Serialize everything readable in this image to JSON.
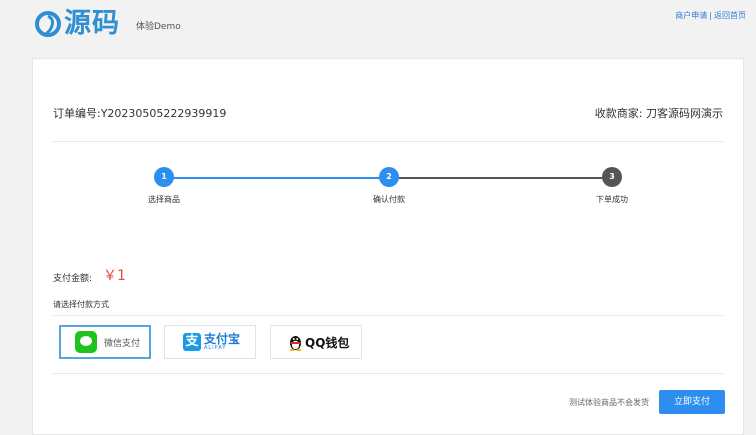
{
  "header": {
    "logo_text": "源码",
    "demo_label": "体验Demo",
    "links": {
      "merchant_apply": "商户申请",
      "separator": "|",
      "back_home": "返回首页"
    }
  },
  "order": {
    "number": "订单编号:Y20230505222939919",
    "merchant": "收款商家: 刀客源码网演示"
  },
  "steps": [
    {
      "num": "1",
      "label": "选择商品",
      "state": "done"
    },
    {
      "num": "2",
      "label": "确认付款",
      "state": "active"
    },
    {
      "num": "3",
      "label": "下单成功",
      "state": "pending"
    }
  ],
  "payment": {
    "amount_label": "支付金额:",
    "amount_value": "￥1",
    "method_label": "请选择付款方式",
    "methods": [
      {
        "name": "微信支付",
        "icon": "wechat-icon",
        "selected": true
      },
      {
        "name": "支付宝",
        "sub": "ALIPAY",
        "icon": "alipay-icon",
        "selected": false
      },
      {
        "name": "QQ钱包",
        "icon": "qq-penguin-icon",
        "selected": false
      }
    ]
  },
  "footer": {
    "notice": "测试体验商品不会发货",
    "pay_button": "立即支付"
  },
  "colors": {
    "brand": "#2f8fd1",
    "step_active": "#2d8ef0",
    "step_pending": "#555555",
    "amount": "#e64b3c",
    "button": "#2d8ef0"
  }
}
